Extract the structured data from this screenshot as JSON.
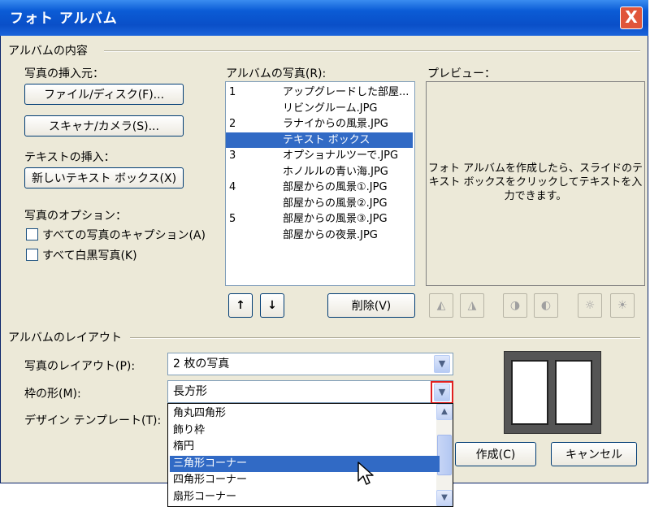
{
  "window": {
    "title": "フォト アルバム",
    "close_label": "X"
  },
  "album_contents": {
    "group_label": "アルバムの内容",
    "insert_from_label": "写真の挿入元：",
    "file_disk_button": "ファイル/ディスク(F)...",
    "scanner_camera_button": "スキャナ/カメラ(S)...",
    "insert_text_label": "テキストの挿入：",
    "new_textbox_button": "新しいテキスト ボックス(X)",
    "picture_options_label": "写真のオプション：",
    "caption_all_label": "すべての写真のキャプション(A)",
    "all_bw_label": "すべて白黒写真(K)"
  },
  "album_photos": {
    "label": "アルバムの写真(R):",
    "items": [
      {
        "num": "1",
        "text": "アップグレードした部屋..."
      },
      {
        "num": "",
        "text": "リビングルーム.JPG"
      },
      {
        "num": "2",
        "text": "ラナイからの風景.JPG"
      },
      {
        "num": "",
        "text": "テキスト ボックス"
      },
      {
        "num": "3",
        "text": "オプショナルツーで.JPG"
      },
      {
        "num": "",
        "text": "ホノルルの青い海.JPG"
      },
      {
        "num": "4",
        "text": "部屋からの風景①.JPG"
      },
      {
        "num": "",
        "text": "部屋からの風景②.JPG"
      },
      {
        "num": "5",
        "text": "部屋からの風景③.JPG"
      },
      {
        "num": "",
        "text": "部屋からの夜景.JPG"
      }
    ],
    "selected_index": 3,
    "move_up_glyph": "↑",
    "move_down_glyph": "↓",
    "remove_button": "削除(V)"
  },
  "preview": {
    "label": "プレビュー：",
    "message": "フォト アルバムを作成したら、スライドのテキスト ボックスをクリックしてテキストを入力できます。"
  },
  "layout_section": {
    "group_label": "アルバムのレイアウト",
    "picture_layout_label": "写真のレイアウト(P):",
    "picture_layout_value": "2 枚の写真",
    "frame_shape_label": "枠の形(M):",
    "frame_shape_value": "長方形",
    "design_template_label": "デザイン テンプレート(T):",
    "frame_options": [
      "角丸四角形",
      "飾り枠",
      "楕円",
      "三角形コーナー",
      "四角形コーナー",
      "扇形コーナー"
    ],
    "frame_selected_index": 3
  },
  "buttons": {
    "create": "作成(C)",
    "cancel": "キャンセル"
  },
  "colors": {
    "selection": "#316ac5",
    "titlebar": "#0a4fc8",
    "highlight_box": "#e02020"
  }
}
